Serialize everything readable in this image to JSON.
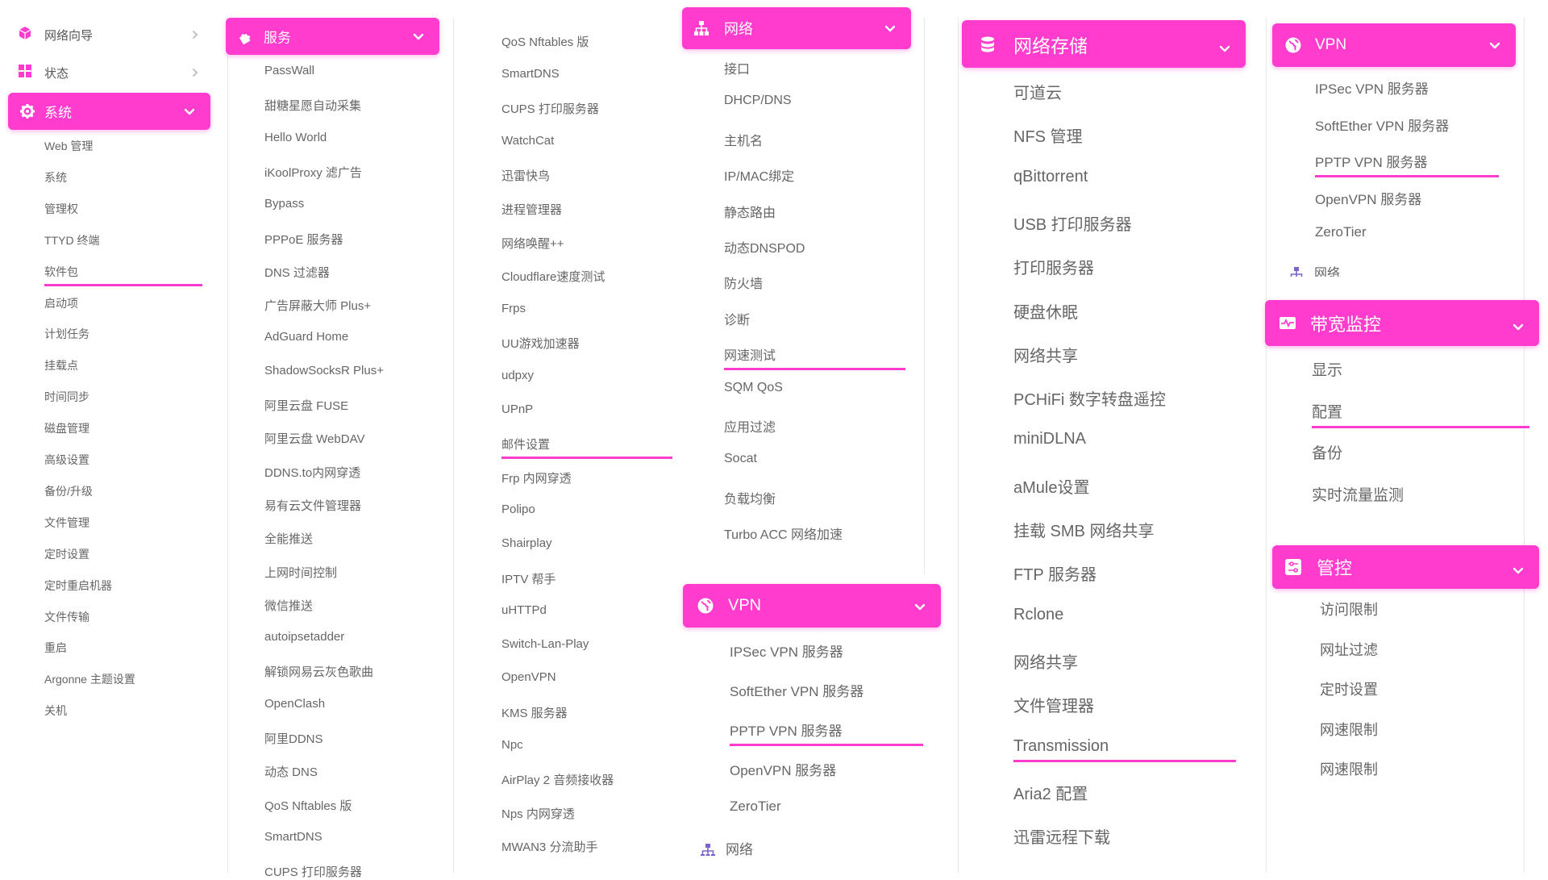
{
  "accent": "#ff3ccd",
  "panel1": {
    "top_items": [
      {
        "label": "网络向导",
        "icon": "box-icon"
      },
      {
        "label": "状态",
        "icon": "grid-icon"
      }
    ],
    "header": {
      "label": "系统",
      "icon": "gear-icon"
    },
    "items": [
      "Web 管理",
      "系统",
      "管理权",
      "TTYD 终端",
      "软件包",
      "启动项",
      "计划任务",
      "挂载点",
      "时间同步",
      "磁盘管理",
      "高级设置",
      "备份/升级",
      "文件管理",
      "定时设置",
      "定时重启机器",
      "文件传输",
      "重启",
      "Argonne 主题设置",
      "关机"
    ],
    "active_item": "软件包"
  },
  "panel2": {
    "header": {
      "label": "服务",
      "icon": "puzzle-icon"
    },
    "items": [
      "PassWall",
      "甜糖星愿自动采集",
      "Hello World",
      "iKoolProxy 滤广告",
      "Bypass",
      "PPPoE 服务器",
      "DNS 过滤器",
      "广告屏蔽大师 Plus+",
      "AdGuard Home",
      "ShadowSocksR Plus+",
      "阿里云盘 FUSE",
      "阿里云盘 WebDAV",
      "DDNS.to内网穿透",
      "易有云文件管理器",
      "全能推送",
      "上网时间控制",
      "微信推送",
      "autoipsetadder",
      "解锁网易云灰色歌曲",
      "OpenClash",
      "阿里DDNS",
      "动态 DNS",
      "QoS Nftables 版",
      "SmartDNS",
      "CUPS 打印服务器"
    ]
  },
  "panel3": {
    "items": [
      "QoS Nftables 版",
      "SmartDNS",
      "CUPS 打印服务器",
      "WatchCat",
      "迅雷快鸟",
      "进程管理器",
      "网络唤醒++",
      "Cloudflare速度测试",
      "Frps",
      "UU游戏加速器",
      "udpxy",
      "UPnP",
      "邮件设置",
      "Frp 内网穿透",
      "Polipo",
      "Shairplay",
      "IPTV 帮手",
      "uHTTPd",
      "Switch-Lan-Play",
      "OpenVPN",
      "KMS 服务器",
      "Npc",
      "AirPlay 2 音频接收器",
      "Nps 内网穿透",
      "MWAN3 分流助手"
    ],
    "active_item": "邮件设置"
  },
  "panel4": {
    "header": {
      "label": "网络",
      "icon": "network-icon"
    },
    "items": [
      "接口",
      "DHCP/DNS",
      "主机名",
      "IP/MAC绑定",
      "静态路由",
      "动态DNSPOD",
      "防火墙",
      "诊断",
      "网速测试",
      "SQM QoS",
      "应用过滤",
      "Socat",
      "负载均衡",
      "Turbo ACC 网络加速"
    ],
    "active_item": "网速测试",
    "vpn_header": {
      "label": "VPN",
      "icon": "globe-icon"
    },
    "vpn_items": [
      "IPSec VPN 服务器",
      "SoftEther VPN 服务器",
      "PPTP VPN 服务器",
      "OpenVPN 服务器",
      "ZeroTier"
    ],
    "vpn_active_item": "PPTP VPN 服务器",
    "tail": {
      "label": "网络",
      "icon": "network-icon"
    }
  },
  "panel5": {
    "header": {
      "label": "网络存储",
      "icon": "database-icon"
    },
    "items": [
      "可道云",
      "NFS 管理",
      "qBittorrent",
      "USB 打印服务器",
      "打印服务器",
      "硬盘休眠",
      "网络共享",
      "PCHiFi 数字转盘遥控",
      "miniDLNA",
      "aMule设置",
      "挂载 SMB 网络共享",
      "FTP 服务器",
      "Rclone",
      "网络共享",
      "文件管理器",
      "Transmission",
      "Aria2 配置",
      "迅雷远程下载"
    ],
    "active_item": "Transmission"
  },
  "panel6": {
    "vpn_header": {
      "label": "VPN",
      "icon": "globe-icon"
    },
    "vpn_items": [
      "IPSec VPN 服务器",
      "SoftEther VPN 服务器",
      "PPTP VPN 服务器",
      "OpenVPN 服务器",
      "ZeroTier"
    ],
    "vpn_active_item": "PPTP VPN 服务器",
    "tail": {
      "label": "网络",
      "icon": "network-icon"
    },
    "bw_header": {
      "label": "带宽监控",
      "icon": "monitor-icon"
    },
    "bw_items": [
      "显示",
      "配置",
      "备份",
      "实时流量监测"
    ],
    "bw_active_item": "配置",
    "ctl_header": {
      "label": "管控",
      "icon": "sliders-icon"
    },
    "ctl_items": [
      "访问限制",
      "网址过滤",
      "定时设置",
      "网速限制",
      "网速限制"
    ]
  }
}
